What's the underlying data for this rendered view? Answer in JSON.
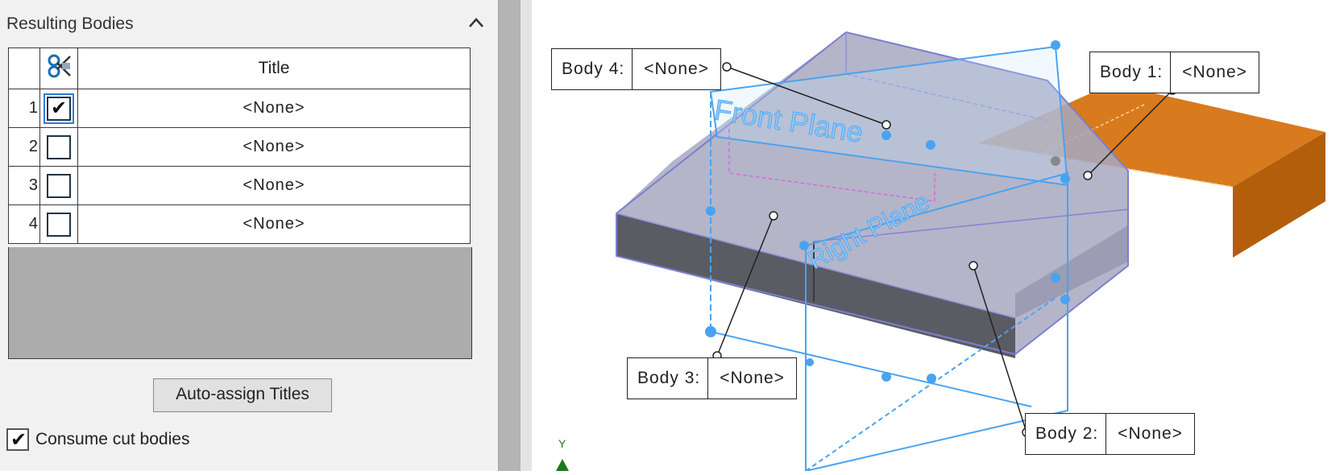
{
  "panel": {
    "heading": "Resulting Bodies",
    "table": {
      "title_header": "Title",
      "rows": [
        {
          "num": "1",
          "checked": true,
          "title": "<None>"
        },
        {
          "num": "2",
          "checked": false,
          "title": "<None>"
        },
        {
          "num": "3",
          "checked": false,
          "title": "<None>"
        },
        {
          "num": "4",
          "checked": false,
          "title": "<None>"
        }
      ]
    },
    "auto_assign_label": "Auto-assign Titles",
    "consume_label": "Consume cut bodies",
    "consume_checked": true
  },
  "viewport": {
    "plane_labels": {
      "front": "Front Plane",
      "right": "Right Plane"
    },
    "axis_label": "Y",
    "callouts": [
      {
        "label": "Body 4:",
        "value": "<None>"
      },
      {
        "label": "Body 1:",
        "value": "<None>"
      },
      {
        "label": "Body 3:",
        "value": "<None>"
      },
      {
        "label": "Body 2:",
        "value": "<None>"
      }
    ]
  },
  "colors": {
    "accent_orange": "#d87a1e",
    "plane_blue": "#4aa3f0",
    "selected_body": "#8f94c4"
  }
}
